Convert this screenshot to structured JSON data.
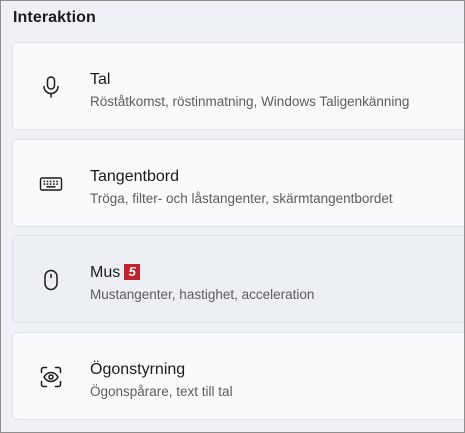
{
  "section": {
    "title": "Interaktion"
  },
  "items": [
    {
      "title": "Tal",
      "subtitle": "Röståtkomst, röstinmatning, Windows Taligenkänning",
      "icon": "microphone-icon"
    },
    {
      "title": "Tangentbord",
      "subtitle": "Tröga, filter- och låstangenter, skärmtangentbordet",
      "icon": "keyboard-icon"
    },
    {
      "title": "Mus",
      "subtitle": "Mustangenter, hastighet, acceleration",
      "icon": "mouse-icon",
      "badge": "5",
      "badge_color": "#c1232e"
    },
    {
      "title": "Ögonstyrning",
      "subtitle": "Ögonspårare, text till tal",
      "icon": "eye-control-icon"
    }
  ],
  "colors": {
    "background": "#eef2f7",
    "card": "#f9fafc",
    "card_hover": "#eceff3",
    "text": "#1b1b1b",
    "subtext": "#5c5c5c"
  }
}
